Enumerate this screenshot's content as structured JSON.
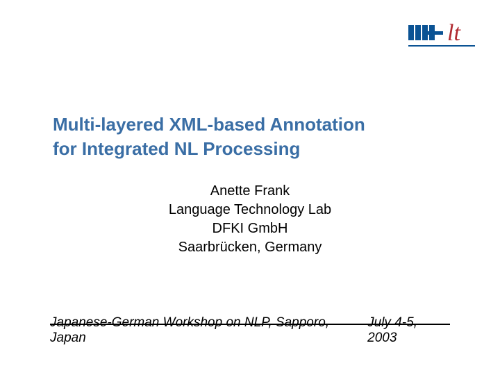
{
  "title": {
    "line1": "Multi-layered XML-based Annotation",
    "line2": "for Integrated NL Processing"
  },
  "author": {
    "name": "Anette Frank",
    "affiliation": "Language Technology Lab",
    "org": "DFKI GmbH",
    "city": "Saarbrücken, Germany"
  },
  "footer": {
    "event": "Japanese-German Workshop on NLP, Sapporo, Japan",
    "date": "July 4-5, 2003"
  },
  "logo": {
    "name": "DFKI lt"
  }
}
